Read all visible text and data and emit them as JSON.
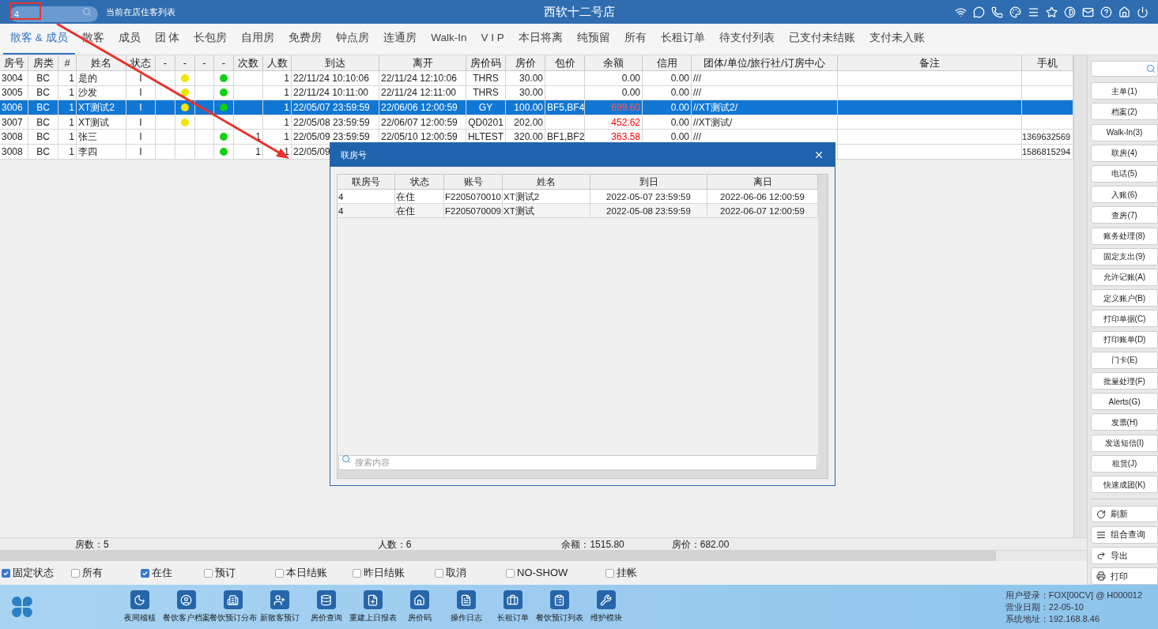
{
  "header": {
    "search": {
      "value": "4"
    },
    "subtitle": "当前在店住客列表",
    "title": "西软十二号店"
  },
  "tabs": [
    {
      "label": "散客 & 成员",
      "selected": true
    },
    {
      "label": "散客",
      "selected": false
    },
    {
      "label": "成员",
      "selected": false
    },
    {
      "label": "团 体",
      "selected": false
    },
    {
      "label": "长包房",
      "selected": false
    },
    {
      "label": "自用房",
      "selected": false
    },
    {
      "label": "免费房",
      "selected": false
    },
    {
      "label": "钟点房",
      "selected": false
    },
    {
      "label": "连通房",
      "selected": false
    },
    {
      "label": "Walk-In",
      "selected": false
    },
    {
      "label": "V I P",
      "selected": false
    },
    {
      "label": "本日将离",
      "selected": false
    },
    {
      "label": "纯预留",
      "selected": false
    },
    {
      "label": "所有",
      "selected": false
    },
    {
      "label": "长租订单",
      "selected": false
    },
    {
      "label": "待支付列表",
      "selected": false
    },
    {
      "label": "已支付未结账",
      "selected": false
    },
    {
      "label": "支付未入账",
      "selected": false
    }
  ],
  "table": {
    "columns": [
      {
        "label": "房号",
        "kind": "text"
      },
      {
        "label": "房类",
        "kind": "text"
      },
      {
        "label": "#",
        "kind": "text"
      },
      {
        "label": "姓名",
        "kind": "text"
      },
      {
        "label": "状态",
        "kind": "text"
      },
      {
        "label": "-",
        "kind": "dot"
      },
      {
        "label": "-",
        "kind": "dot"
      },
      {
        "label": "-",
        "kind": "dot"
      },
      {
        "label": "-",
        "kind": "dot"
      },
      {
        "label": "次数",
        "kind": "text"
      },
      {
        "label": "人数",
        "kind": "text"
      },
      {
        "label": "到达",
        "kind": "text"
      },
      {
        "label": "离开",
        "kind": "text"
      },
      {
        "label": "房价码",
        "kind": "text"
      },
      {
        "label": "房价",
        "kind": "text"
      },
      {
        "label": "包价",
        "kind": "text"
      },
      {
        "label": "余额",
        "kind": "text"
      },
      {
        "label": "信用",
        "kind": "text"
      },
      {
        "label": "团体/单位/旅行社/订房中心",
        "kind": "text"
      },
      {
        "label": "备注",
        "kind": "text"
      },
      {
        "label": "手机",
        "kind": "text"
      }
    ],
    "rows": [
      {
        "selected": false,
        "balance_highlighted": false,
        "dots": [
          {
            "on": false
          },
          {
            "on": true,
            "color": "#f2e600"
          },
          {
            "on": false
          },
          {
            "on": true,
            "color": "#10d010"
          }
        ],
        "cells": [
          "3004",
          "BC",
          "1",
          "是的",
          "I",
          null,
          null,
          null,
          null,
          null,
          "1",
          "22/11/24 10:10:06",
          "22/11/24 12:10:06",
          "THRS",
          "30.00",
          null,
          "0.00",
          "0.00",
          "///",
          null,
          null
        ]
      },
      {
        "selected": false,
        "balance_highlighted": false,
        "dots": [
          {
            "on": false
          },
          {
            "on": true,
            "color": "#f2e600"
          },
          {
            "on": false
          },
          {
            "on": true,
            "color": "#10d010"
          }
        ],
        "cells": [
          "3005",
          "BC",
          "1",
          "沙发",
          "I",
          null,
          null,
          null,
          null,
          null,
          "1",
          "22/11/24 10:11:00",
          "22/11/24 12:11:00",
          "THRS",
          "30.00",
          null,
          "0.00",
          "0.00",
          "///",
          null,
          null
        ]
      },
      {
        "selected": true,
        "balance_highlighted": true,
        "dots": [
          {
            "on": false
          },
          {
            "on": true,
            "color": "#f2e600"
          },
          {
            "on": false
          },
          {
            "on": true,
            "color": "#10d010"
          }
        ],
        "cells": [
          "3006",
          "BC",
          "1",
          "XT测试2",
          "I",
          null,
          null,
          null,
          null,
          null,
          "1",
          "22/05/07 23:59:59",
          "22/06/06 12:00:59",
          "GY",
          "100.00",
          "BF5,BF4",
          "699.60",
          "0.00",
          "//XT测试2/",
          null,
          null
        ]
      },
      {
        "selected": false,
        "balance_highlighted": true,
        "dots": [
          {
            "on": false
          },
          {
            "on": true,
            "color": "#f2e600"
          },
          {
            "on": false
          },
          {
            "on": false
          }
        ],
        "cells": [
          "3007",
          "BC",
          "1",
          "XT测试",
          "I",
          null,
          null,
          null,
          null,
          null,
          "1",
          "22/05/08 23:59:59",
          "22/06/07 12:00:59",
          "QD0201",
          "202.00",
          null,
          "452.62",
          "0.00",
          "//XT测试/",
          null,
          null
        ]
      },
      {
        "selected": false,
        "balance_highlighted": true,
        "dots": [
          {
            "on": false
          },
          {
            "on": false
          },
          {
            "on": false
          },
          {
            "on": true,
            "color": "#10d010"
          }
        ],
        "cells": [
          "3008",
          "BC",
          "1",
          "张三",
          "I",
          null,
          null,
          null,
          null,
          "1",
          "1",
          "22/05/09 23:59:59",
          "22/05/10 12:00:59",
          "HLTEST",
          "320.00",
          "BF1,BF2",
          "363.58",
          "0.00",
          "///",
          null,
          "1369632569"
        ]
      },
      {
        "selected": false,
        "dots": [
          {
            "on": false
          },
          {
            "on": false
          },
          {
            "on": false
          },
          {
            "on": true,
            "color": "#10d010"
          }
        ],
        "cells": [
          "3008",
          "BC",
          "1",
          "李四",
          "I",
          null,
          null,
          null,
          null,
          "1",
          "1",
          "22/05/09",
          null,
          null,
          null,
          null,
          null,
          null,
          null,
          null,
          "1586815294"
        ]
      }
    ],
    "summary": [
      "房数：5",
      "人数：6",
      "余额：1515.80",
      "房价：682.00"
    ]
  },
  "filters": [
    {
      "label": "固定状态",
      "checked": true
    },
    {
      "label": "所有",
      "checked": false
    },
    {
      "label": "在住",
      "checked": true
    },
    {
      "label": "预订",
      "checked": false
    },
    {
      "label": "本日结账",
      "checked": false
    },
    {
      "label": "昨日结账",
      "checked": false
    },
    {
      "label": "取消",
      "checked": false
    },
    {
      "label": "NO-SHOW",
      "checked": false
    },
    {
      "label": "挂帐",
      "checked": false
    }
  ],
  "side_panel": {
    "buttons": [
      "主单(1)",
      "档案(2)",
      "Walk-In(3)",
      "联房(4)",
      "电话(5)",
      "入账(6)",
      "查房(7)",
      "账务处理(8)",
      "固定支出(9)",
      "允许记账(A)",
      "定义账户(B)",
      "打印单据(C)",
      "打印账单(D)",
      "门卡(E)",
      "批量处理(F)",
      "Alerts(G)",
      "发票(H)",
      "发送短信(I)",
      "租赁(J)",
      "快速成团(K)"
    ],
    "tools": [
      {
        "kind": "refresh",
        "label": "刷新"
      },
      {
        "kind": "list",
        "label": "组合查询"
      },
      {
        "kind": "export",
        "label": "导出"
      },
      {
        "kind": "print",
        "label": "打印"
      }
    ]
  },
  "dialog": {
    "title": "联房号",
    "columns": [
      "联房号",
      "状态",
      "账号",
      "姓名",
      "到日",
      "离日"
    ],
    "rows": [
      [
        "4",
        "在住",
        "F2205070010",
        "XT测试2",
        "2022-05-07 23:59:59",
        "2022-06-06 12:00:59"
      ],
      [
        "4",
        "在住",
        "F2205070009",
        "XT测试",
        "2022-05-08 23:59:59",
        "2022-06-07 12:00:59"
      ]
    ],
    "search": {
      "placeholder": "搜索内容"
    }
  },
  "dock": [
    {
      "kind": "moon",
      "label": "夜间稽核"
    },
    {
      "kind": "user",
      "label": "餐饮客户档案"
    },
    {
      "kind": "building",
      "label": "餐饮预订分布"
    },
    {
      "kind": "user-plus",
      "label": "新散客预订"
    },
    {
      "kind": "database",
      "label": "房价查询"
    },
    {
      "kind": "file-plus",
      "label": "重建上日报表"
    },
    {
      "kind": "home",
      "label": "房价码"
    },
    {
      "kind": "file-text",
      "label": "操作日志"
    },
    {
      "kind": "suitcase",
      "label": "长租订单"
    },
    {
      "kind": "clipboard",
      "label": "餐饮预订列表"
    },
    {
      "kind": "wrench",
      "label": "维护模块"
    }
  ],
  "status": [
    "用户登录：FOX[00CV] @ H000012",
    "营业日期：22-05-10",
    "系统地址：192.168.8.46"
  ]
}
